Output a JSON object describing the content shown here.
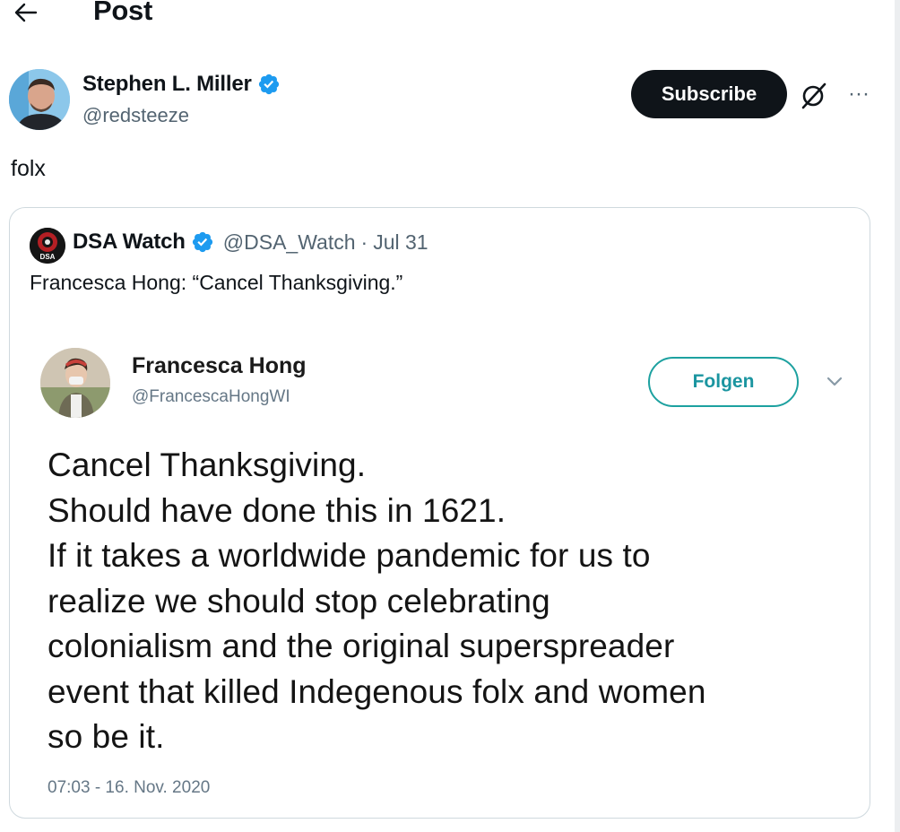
{
  "header": {
    "back_icon": "arrow-left-icon",
    "title": "Post"
  },
  "tweet": {
    "author_name": "Stephen L. Miller",
    "author_handle": "@redsteeze",
    "verified_icon": "verified-badge-icon",
    "subscribe_label": "Subscribe",
    "grok_icon": "grok-icon",
    "more_icon": "more-horizontal-icon",
    "more_glyph": "···",
    "text": "folx"
  },
  "quote": {
    "author_name": "DSA Watch",
    "author_handle": "@DSA_Watch",
    "separator": "·",
    "date": "Jul 31",
    "avatar_text": "DSA",
    "text": "Francesca Hong: “Cancel Thanksgiving.”"
  },
  "embedded_tweet": {
    "author_name": "Francesca Hong",
    "author_handle": "@FrancescaHongWI",
    "follow_label": "Folgen",
    "chevron_icon": "chevron-down-icon",
    "lines": [
      "Cancel Thanksgiving.",
      "Should have done this in 1621.",
      "If it takes a worldwide pandemic for us to",
      "realize we should stop celebrating",
      "colonialism and the original superspreader",
      "event that killed Indegenous folx and women",
      "so be it."
    ],
    "timestamp": "07:03 - 16. Nov. 2020"
  },
  "colors": {
    "verified_blue": "#1d9bf0",
    "text_primary": "#0f1419",
    "text_secondary": "#536471",
    "follow_teal": "#1da1a0",
    "border": "#cfd9de"
  }
}
